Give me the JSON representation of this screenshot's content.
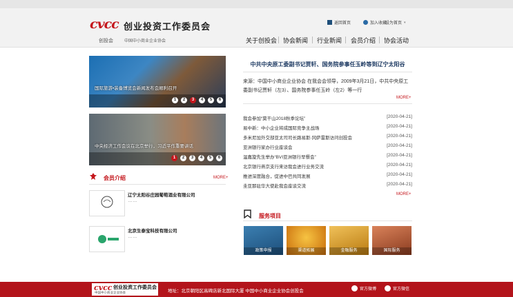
{
  "logo": {
    "mark": "cvcc",
    "name": "创业投资工作委员会",
    "short": "创投会",
    "sub": "中国中小商业企业协会"
  },
  "toplinks": {
    "home": "返回首页",
    "join": "加入收藏",
    "set_home": "设为首页"
  },
  "nav": [
    "关于创投会",
    "协会新闻",
    "行业新闻",
    "会员介绍",
    "协会活动"
  ],
  "banners": [
    {
      "caption": "国际旅游•装备博览会新闻发布会顺利召开",
      "pages": [
        "1",
        "2",
        "3",
        "4",
        "5",
        "6"
      ],
      "active": 2
    },
    {
      "caption": "中央经济工作会议在北京举行，习近平作重要讲话",
      "pages": [
        "1",
        "2",
        "3",
        "4",
        "5",
        "6"
      ],
      "active": 0
    }
  ],
  "members": {
    "title": "会员介绍",
    "more": "MORE+",
    "items": [
      {
        "name": "辽宁太阳谷庄园葡萄酒业有限公司",
        "desc": "……",
        "logo": "太阳谷"
      },
      {
        "name": "北京生泰宝科技有限公司",
        "desc": "……",
        "logo": "生泰宝"
      }
    ]
  },
  "headline": {
    "title": "中共中央原工委副书记贾轩、国务院参事任玉岭等到辽宁太阳谷",
    "summary": "来源：中国中小商业企业协会 在我会会领导，2009年3月21日，中共中央原工委副书记贾轩（左3）、国务院参事任玉岭（左2）等一行",
    "more": "MORE+"
  },
  "news": {
    "more": "MORE+",
    "items": [
      {
        "title": "我会参加“莫干山2018秋季论坛”",
        "date": "[2020-04-21]"
      },
      {
        "title": "易中新：中小企业将成国际竞争主战场",
        "date": "[2020-04-21]"
      },
      {
        "title": "多米尼加外交部亚太司司长路易斯·冈萨雷斯访问创投会",
        "date": "[2020-04-21]"
      },
      {
        "title": "亚洲银行家办行业座谈会",
        "date": "[2020-04-21]"
      },
      {
        "title": "温嘉旋先生举办“BVI亚洲银行早餐会”",
        "date": "[2020-04-21]"
      },
      {
        "title": "北京银行燕京支行来访我会进行业务交流",
        "date": "[2020-04-21]"
      },
      {
        "title": "推进深度融合，促进中巴共同发展",
        "date": "[2020-04-21]"
      },
      {
        "title": "圭亚那驻华大使赴我会座谈交流",
        "date": "[2020-04-21]"
      }
    ]
  },
  "services": {
    "title": "服务项目",
    "items": [
      {
        "label": "政策申报",
        "color": "#2f6f9f"
      },
      {
        "label": "渠道拓展",
        "color": "#d98a12"
      },
      {
        "label": "金融服务",
        "color": "#d4a21a"
      },
      {
        "label": "国际服务",
        "color": "#b84f2a"
      }
    ]
  },
  "footer": {
    "address": "地址：北京朝阳区高碑店新北国际大厦 中国中小商业企业协会创投会",
    "weibo": "官方微博",
    "wechat": "官方微信"
  },
  "colors": {
    "brand_red": "#c4161c",
    "footer_red": "#b3141b",
    "headline_blue": "#1f3b63"
  }
}
